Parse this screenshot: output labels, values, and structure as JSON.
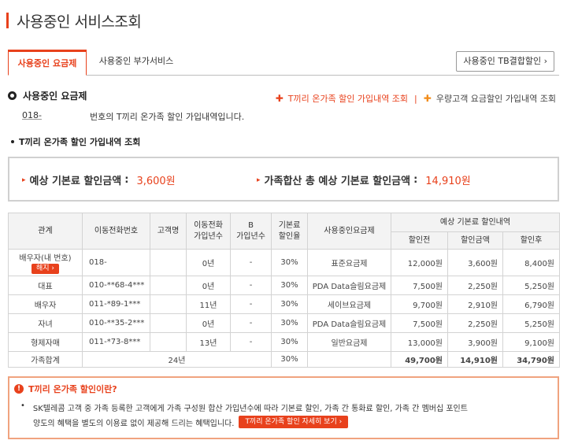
{
  "page": {
    "title": "사용중인 서비스조회"
  },
  "tabs": [
    {
      "label": "사용중인 요금제"
    },
    {
      "label": "사용중인 부가서비스"
    }
  ],
  "tb_button": {
    "label": "사용중인 TB결합할인 ›"
  },
  "section": {
    "title": "사용중인 요금제",
    "links": {
      "discount_history": "T끼리 온가족 할인 가입내역 조회",
      "separator": "|",
      "loyal_discount": "우량고객 요금할인 가입내역 조회"
    },
    "number_prefix": "018-",
    "number_desc": "번호의 T끼리 온가족 할인 가입내역입니다."
  },
  "sub_section": {
    "title": "T끼리 온가족 할인 가입내역 조회"
  },
  "summary": {
    "expected_label": "예상 기본료 할인금액",
    "expected_value": "3,600원",
    "total_label": "가족합산 총 예상 기본료 할인금액",
    "total_value": "14,910원",
    "colon": ":"
  },
  "table": {
    "headers": {
      "relation": "관계",
      "phone": "이동전화번호",
      "customer": "고객명",
      "years_a1": "이동전화",
      "years_a2": "가입년수",
      "years_b1": "B",
      "years_b2": "가입년수",
      "rate1": "기본료",
      "rate2": "할인율",
      "plan": "사용중인요금제",
      "group": "예상 기본료 할인내역",
      "before": "할인전",
      "amount": "할인금액",
      "after": "할인후"
    },
    "cancel_label": "해지 ›",
    "rows": [
      {
        "relation": "배우자(내 번호)",
        "phone": "018-",
        "customer": "",
        "years": "0년",
        "b_years": "-",
        "rate": "30%",
        "plan": "표준요금제",
        "before": "12,000원",
        "amount": "3,600원",
        "after": "8,400원"
      },
      {
        "relation": "대표",
        "phone": "010-**68-4***",
        "customer": "",
        "years": "0년",
        "b_years": "-",
        "rate": "30%",
        "plan": "PDA Data슬림요금제",
        "before": "7,500원",
        "amount": "2,250원",
        "after": "5,250원"
      },
      {
        "relation": "배우자",
        "phone": "011-*89-1***",
        "customer": "",
        "years": "11년",
        "b_years": "-",
        "rate": "30%",
        "plan": "세이브요금제",
        "before": "9,700원",
        "amount": "2,910원",
        "after": "6,790원"
      },
      {
        "relation": "자녀",
        "phone": "010-**35-2***",
        "customer": "",
        "years": "0년",
        "b_years": "-",
        "rate": "30%",
        "plan": "PDA Data슬림요금제",
        "before": "7,500원",
        "amount": "2,250원",
        "after": "5,250원"
      },
      {
        "relation": "형제자매",
        "phone": "011-*73-8***",
        "customer": "",
        "years": "13년",
        "b_years": "-",
        "rate": "30%",
        "plan": "일반요금제",
        "before": "13,000원",
        "amount": "3,900원",
        "after": "9,100원"
      }
    ],
    "total": {
      "label": "가족합계",
      "years": "24년",
      "rate": "30%",
      "before": "49,700원",
      "amount": "14,910원",
      "after": "34,790원"
    }
  },
  "info": {
    "title": "T끼리 온가족 할인이란?",
    "line1": "SK텔레콤 고객 중 가족 등록한 고객에게 가족 구성원 합산 가입년수에 따라 기본료 할인, 가족 간 통화료 할인, 가족 간 멤버십 포인트",
    "line2": "양도의 혜택을 별도의 이용료 없이 제공해 드리는 혜택입니다.",
    "detail_button": "T끼리 온가족 할인 자세히 보기 ›",
    "bullet": "•"
  },
  "colors": {
    "accent": "#e8411c",
    "orange": "#f28c1a",
    "info_border": "#f0a37f"
  }
}
